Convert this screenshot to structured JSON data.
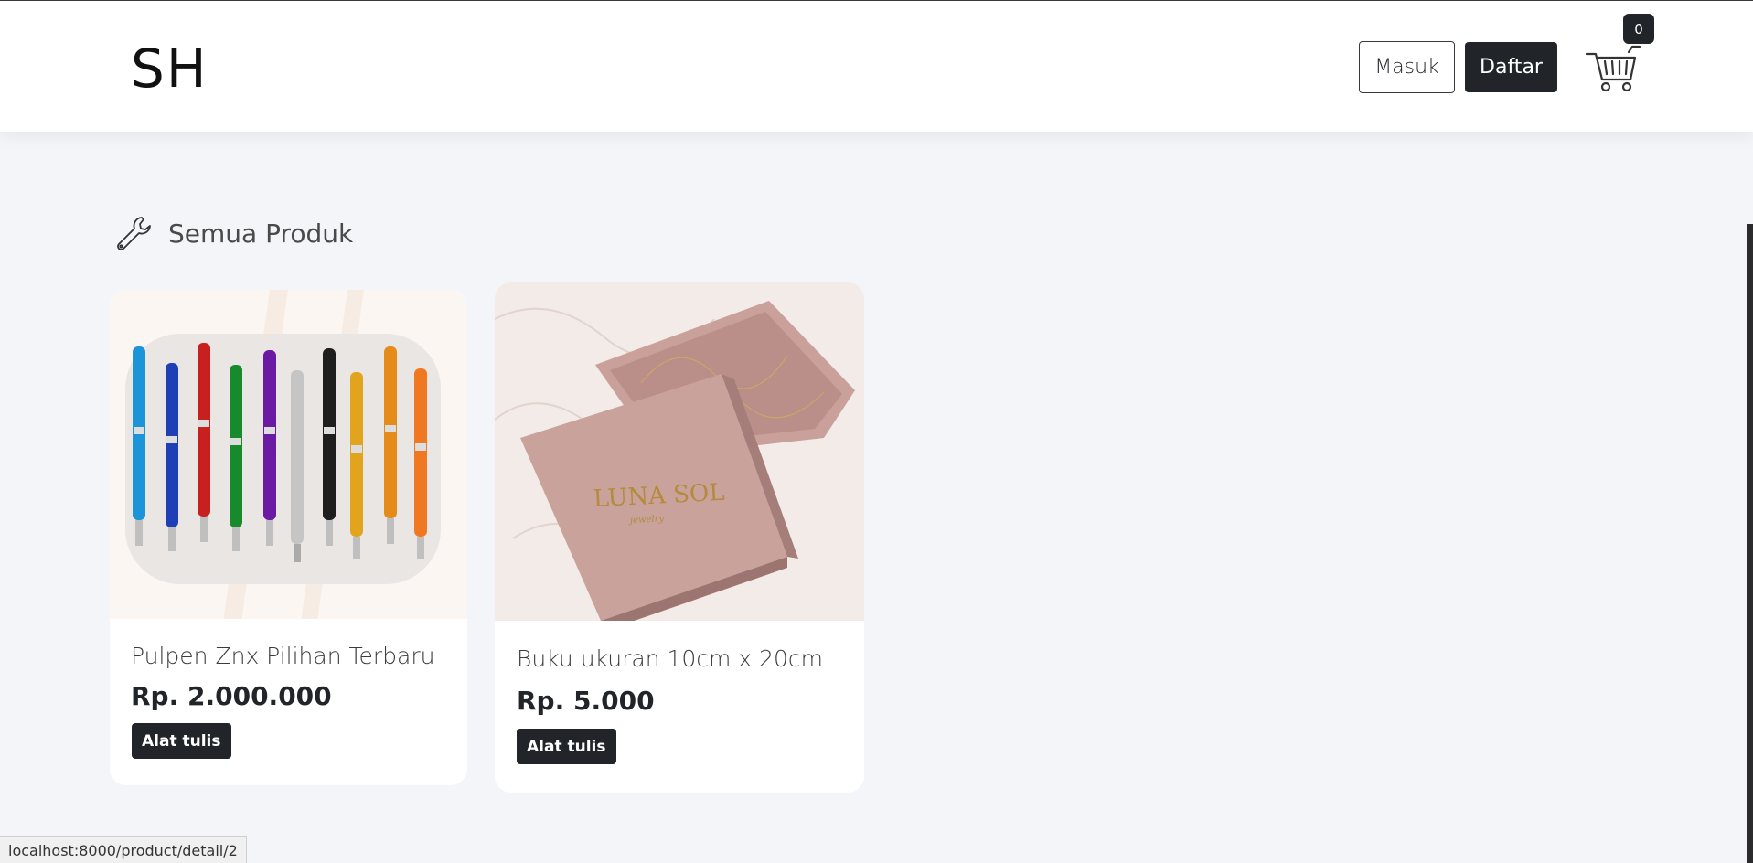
{
  "header": {
    "brand": "SH",
    "login_label": "Masuk",
    "register_label": "Daftar",
    "cart_count": "0"
  },
  "section": {
    "title": "Semua Produk",
    "icon": "wrench-icon"
  },
  "products": [
    {
      "name": "Pulpen Znx Pilihan Terbaru",
      "price": "Rp. 2.000.000",
      "category": "Alat tulis",
      "image": "colorful-pens"
    },
    {
      "name": "Buku ukuran 10cm x 20cm",
      "price": "Rp. 5.000",
      "category": "Alat tulis",
      "image": "pink-box-luna-sol",
      "image_text": "LUNA SOL",
      "image_subtext": "jewelry"
    }
  ],
  "statusbar": {
    "url": "localhost:8000/product/detail/2"
  },
  "colors": {
    "accent_dark": "#212529",
    "page_bg": "#f4f5f9",
    "box_pink": "#c9a09a"
  }
}
